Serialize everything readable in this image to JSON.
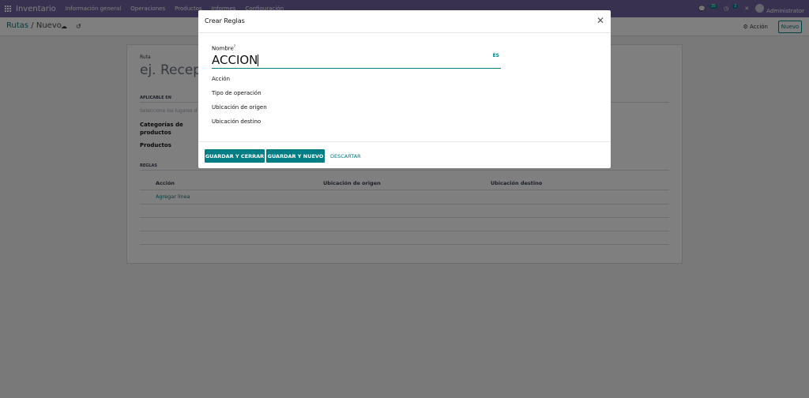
{
  "topbar": {
    "app_name": "Inventario",
    "menu": [
      "Información general",
      "Operaciones",
      "Productos",
      "Informes",
      "Configuración"
    ],
    "messages_count": "35",
    "activities_count": "2",
    "user": "Administrator"
  },
  "control": {
    "breadcrumb_parent": "Rutas",
    "breadcrumb_sep": "/",
    "breadcrumb_current": "Nuevo",
    "action_label": "Acción",
    "new_label": "Nuevo"
  },
  "form": {
    "ruta_label": "Ruta",
    "name_placeholder": "ej. Recepc",
    "section_applicable": "APLICABLE EN",
    "applicable_hint": "Seleccione los lugares d",
    "categories_label": "Categorías de productos",
    "products_label": "Productos",
    "section_rules": "REGLAS",
    "columns": [
      "Acción",
      "Ubicación de origen",
      "Ubicación destino"
    ],
    "add_line": "Agregar línea"
  },
  "modal": {
    "title": "Crear Reglas",
    "name_label": "Nombre",
    "name_value": "ACCION",
    "lang_button": "ES",
    "fields": [
      "Acción",
      "Tipo de operación",
      "Ubicación de origen",
      "Ubicación destino"
    ],
    "save_close": "GUARDAR Y CERRAR",
    "save_new": "GUARDAR Y NUEVO",
    "discard": "DESCARTAR"
  },
  "colors": {
    "brand": "#71639e",
    "accent": "#017e84"
  }
}
